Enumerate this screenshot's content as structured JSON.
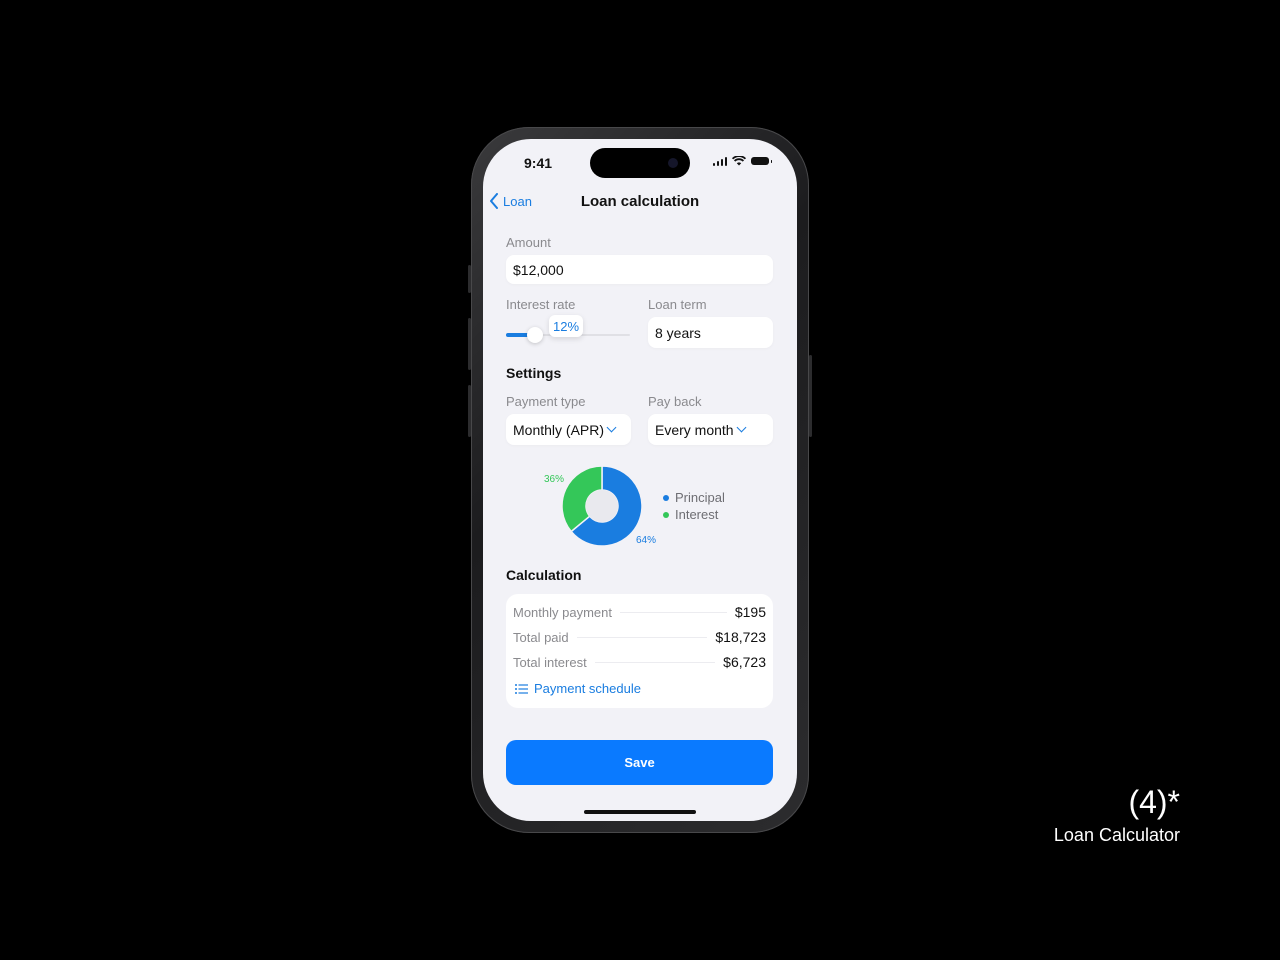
{
  "status_bar": {
    "time": "9:41",
    "icons": [
      "cellular-signal-icon",
      "wifi-icon",
      "battery-icon"
    ]
  },
  "nav": {
    "back_label": "Loan",
    "back_icon": "chevron-left-icon",
    "title": "Loan calculation"
  },
  "amount": {
    "label": "Amount",
    "value": "$12,000"
  },
  "interest_rate": {
    "label": "Interest rate",
    "value_label": "12%",
    "slider_fraction": 0.23
  },
  "loan_term": {
    "label": "Loan term",
    "value": "8 years"
  },
  "settings": {
    "title": "Settings",
    "payment_type": {
      "label": "Payment type",
      "value": "Monthly (APR)"
    },
    "pay_back": {
      "label": "Pay back",
      "value": "Every month"
    }
  },
  "chart_data": {
    "type": "pie",
    "donut": true,
    "slices": [
      {
        "name": "Principal",
        "value": 64,
        "label": "64%",
        "color": "#1a7de0"
      },
      {
        "name": "Interest",
        "value": 36,
        "label": "36%",
        "color": "#34c759"
      }
    ],
    "legend": [
      "Principal",
      "Interest"
    ],
    "legend_position": "right"
  },
  "calculation": {
    "title": "Calculation",
    "rows": [
      {
        "label": "Monthly payment",
        "value": "$195"
      },
      {
        "label": "Total paid",
        "value": "$18,723"
      },
      {
        "label": "Total interest",
        "value": "$6,723"
      }
    ],
    "schedule_link": "Payment schedule"
  },
  "save_label": "Save",
  "caption": {
    "number": "(4)*",
    "title": "Loan Calculator"
  },
  "colors": {
    "accent": "#0a7aff",
    "principal": "#1a7de0",
    "interest": "#34c759",
    "background": "#f2f2f7"
  }
}
